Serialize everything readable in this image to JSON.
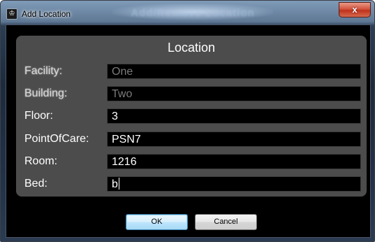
{
  "window": {
    "title": "Add Location",
    "background_title": "Add/Remove Location",
    "close_label": "x"
  },
  "panel": {
    "title": "Location",
    "fields": [
      {
        "label": "Facility:",
        "value": "One",
        "enabled": false
      },
      {
        "label": "Building:",
        "value": "Two",
        "enabled": false
      },
      {
        "label": "Floor:",
        "value": "3",
        "enabled": true
      },
      {
        "label": "PointOfCare:",
        "value": "PSN7",
        "enabled": true
      },
      {
        "label": "Room:",
        "value": "1216",
        "enabled": true
      },
      {
        "label": "Bed:",
        "value": "b",
        "enabled": true
      }
    ]
  },
  "buttons": {
    "ok_label": "OK",
    "cancel_label": "Cancel"
  },
  "icons": {
    "app": "app-icon",
    "close": "close-icon"
  },
  "colors": {
    "panel": "#4c4c4c",
    "field_bg": "#000000",
    "label": "#ffffff",
    "disabled_value": "#7a7a7a"
  }
}
